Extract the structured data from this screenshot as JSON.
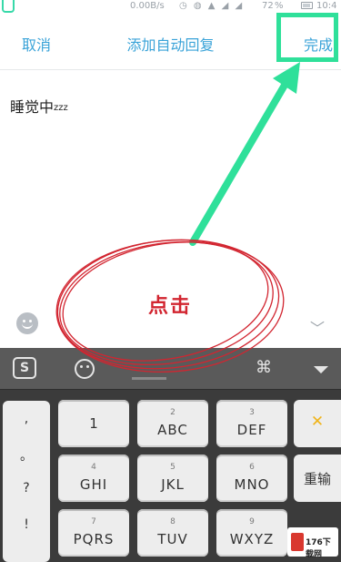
{
  "status_bar": {
    "speed": "0.00B/s",
    "battery": "72",
    "time": "10:4"
  },
  "header": {
    "cancel_label": "取消",
    "title": "添加自动回复",
    "done_label": "完成"
  },
  "editor": {
    "text": "睡觉中",
    "suffix": "zzz"
  },
  "annotation": {
    "label": "点击",
    "highlight_color": "#2fe09a",
    "circle_color": "#d22530"
  },
  "keyboard": {
    "toolbar": {
      "logo": "S",
      "cmd_glyph": "⌘"
    },
    "punctuation": [
      ",",
      "。",
      "?",
      "!"
    ],
    "keys": [
      {
        "num": "",
        "letters": "1"
      },
      {
        "num": "2",
        "letters": "ABC"
      },
      {
        "num": "3",
        "letters": "DEF"
      },
      {
        "num": "4",
        "letters": "GHI"
      },
      {
        "num": "5",
        "letters": "JKL"
      },
      {
        "num": "6",
        "letters": "MNO"
      },
      {
        "num": "7",
        "letters": "PQRS"
      },
      {
        "num": "8",
        "letters": "TUV"
      },
      {
        "num": "9",
        "letters": "WXYZ"
      }
    ],
    "delete_glyph": "✕",
    "reenter_label": "重输"
  },
  "watermark": {
    "text": "176下载网"
  }
}
